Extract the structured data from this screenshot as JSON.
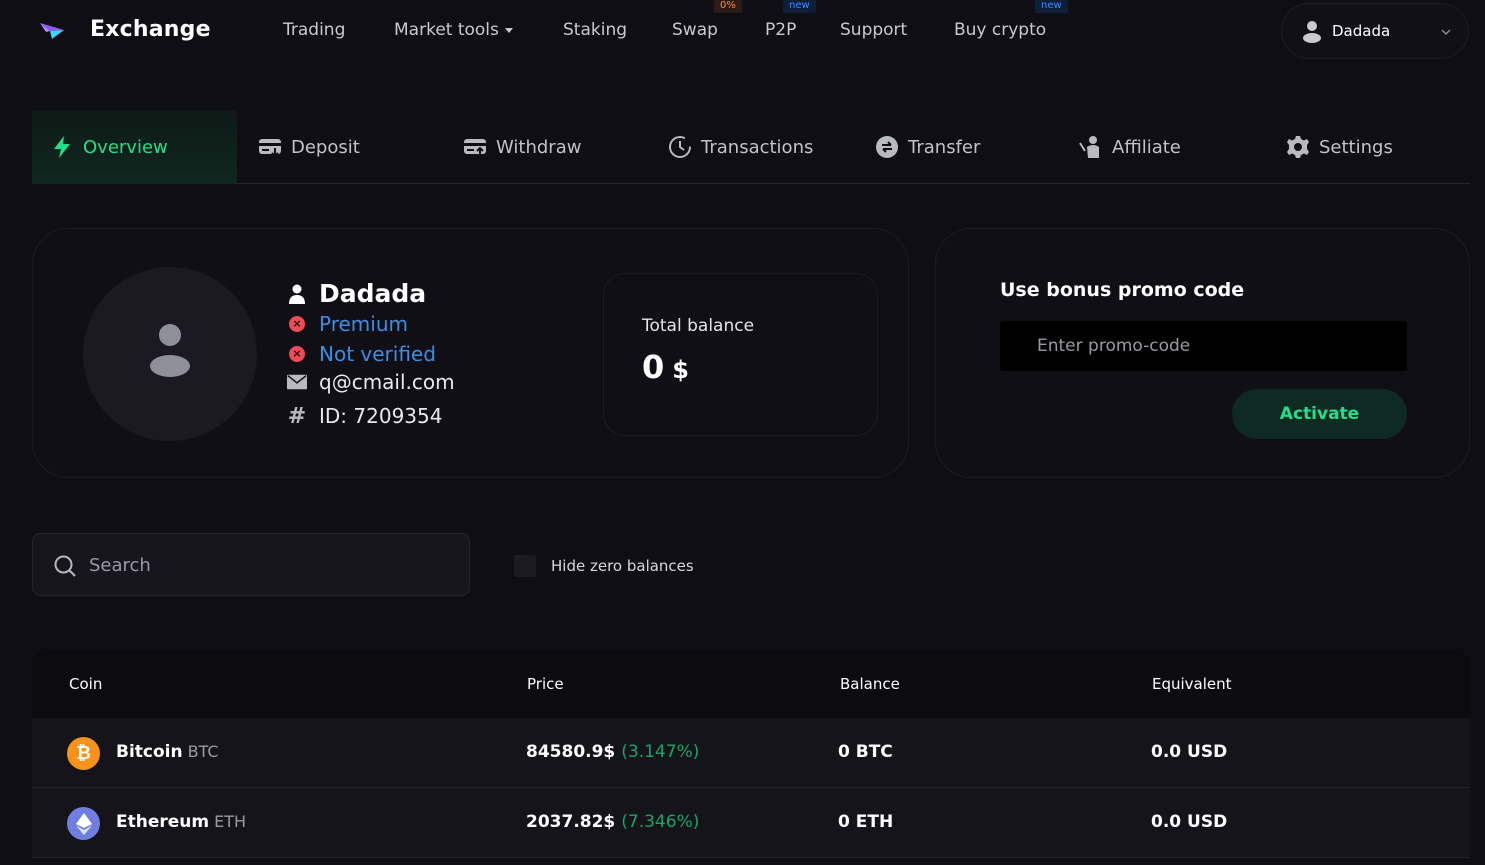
{
  "header": {
    "brand": "Exchange",
    "nav": [
      {
        "label": "Trading"
      },
      {
        "label": "Market tools"
      },
      {
        "label": "Staking"
      },
      {
        "label": "Swap",
        "badge": "0%"
      },
      {
        "label": "P2P",
        "badge": "new"
      },
      {
        "label": "Support"
      },
      {
        "label": "Buy crypto",
        "badge": "new"
      }
    ],
    "user": "Dadada"
  },
  "tabs": [
    {
      "label": "Overview",
      "icon": "lightning-icon",
      "active": true
    },
    {
      "label": "Deposit",
      "icon": "deposit-card-icon"
    },
    {
      "label": "Withdraw",
      "icon": "withdraw-card-icon"
    },
    {
      "label": "Transactions",
      "icon": "history-icon"
    },
    {
      "label": "Transfer",
      "icon": "transfer-icon"
    },
    {
      "label": "Affiliate",
      "icon": "affiliate-icon"
    },
    {
      "label": "Settings",
      "icon": "gear-icon"
    }
  ],
  "profile": {
    "name": "Dadada",
    "tier": "Premium",
    "verification": "Not verified",
    "email": "q@cmail.com",
    "id": "ID: 7209354"
  },
  "balance": {
    "label": "Total balance",
    "value": "0",
    "currency": "$"
  },
  "promo": {
    "title": "Use bonus promo code",
    "placeholder": "Enter promo-code",
    "button": "Activate"
  },
  "filter": {
    "search_placeholder": "Search",
    "hide_zero_label": "Hide zero balances"
  },
  "table": {
    "headers": [
      "Coin",
      "Price",
      "Balance",
      "Equivalent"
    ],
    "rows": [
      {
        "name": "Bitcoin",
        "ticker": "BTC",
        "price": "84580.9$",
        "change": "(3.147%)",
        "balance": "0 BTC",
        "equivalent": "0.0 USD",
        "icon_color": "#f7931a",
        "icon": "bitcoin-icon"
      },
      {
        "name": "Ethereum",
        "ticker": "ETH",
        "price": "2037.82$",
        "change": "(7.346%)",
        "balance": "0 ETH",
        "equivalent": "0.0 USD",
        "icon_color": "#6f7fe0",
        "icon": "ethereum-icon"
      }
    ]
  },
  "colors": {
    "accent": "#1fe08a",
    "link_blue": "#3a8ee6",
    "error": "#f04b52",
    "background": "#0f0e14"
  }
}
